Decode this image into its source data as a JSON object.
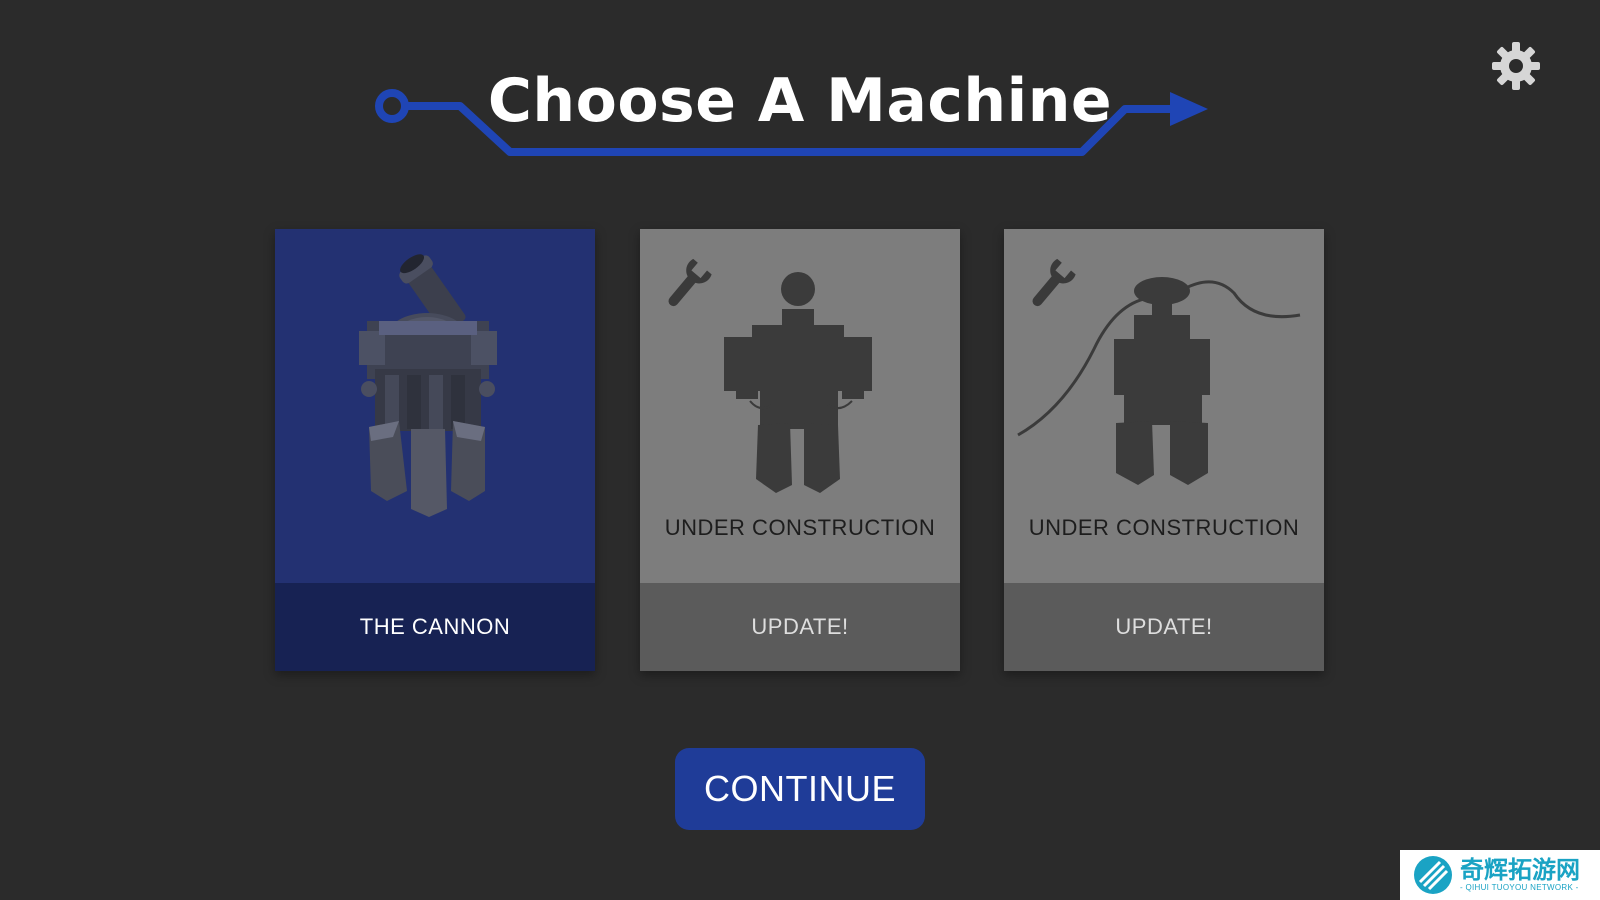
{
  "title": "Choose A Machine",
  "colors": {
    "background": "#2b2b2b",
    "accent_blue": "#1f3c98",
    "circuit_line": "#1f45b5",
    "selected_card": "#233172",
    "selected_footer": "#172253",
    "locked_card": "#7d7d7d",
    "locked_footer": "#5b5b5b"
  },
  "settings": {
    "icon": "gear-icon"
  },
  "machines": [
    {
      "name": "THE CANNON",
      "state": "selected",
      "icon": "cannon-machine"
    },
    {
      "status": "UNDER CONSTRUCTION",
      "name": "UPDATE!",
      "state": "locked",
      "icon": "wrench-icon"
    },
    {
      "status": "UNDER CONSTRUCTION",
      "name": "UPDATE!",
      "state": "locked",
      "icon": "wrench-icon"
    }
  ],
  "continue_label": "CONTINUE",
  "watermark": {
    "cn": "奇辉拓游网",
    "en": "- QIHUI TUOYOU NETWORK -"
  }
}
